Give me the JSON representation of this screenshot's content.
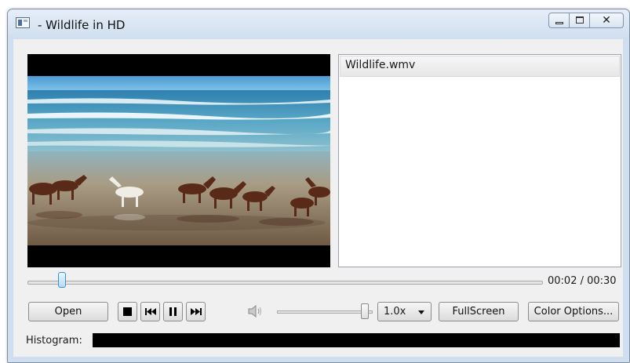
{
  "window": {
    "title": " - Wildlife in HD",
    "close_glyph": "✕"
  },
  "playlist": {
    "items": [
      "Wildlife.wmv"
    ],
    "selected_index": 0
  },
  "seek": {
    "position_fraction": 0.067,
    "time": "00:02 / 00:30"
  },
  "controls": {
    "open_label": "Open",
    "volume_fraction": 0.93,
    "speed": "1.0x",
    "fullscreen_label": "FullScreen",
    "color_options_label": "Color Options..."
  },
  "histogram": {
    "label": "Histogram:"
  },
  "icons": [
    "app-icon",
    "minimize-icon",
    "maximize-icon",
    "close-icon",
    "stop-icon",
    "previous-icon",
    "pause-icon",
    "next-icon",
    "speaker-icon",
    "dropdown-arrow-icon"
  ],
  "colors": {
    "accent": "#3b8fd6",
    "frame": "#cfdff0",
    "panel": "#f0f0f0"
  }
}
